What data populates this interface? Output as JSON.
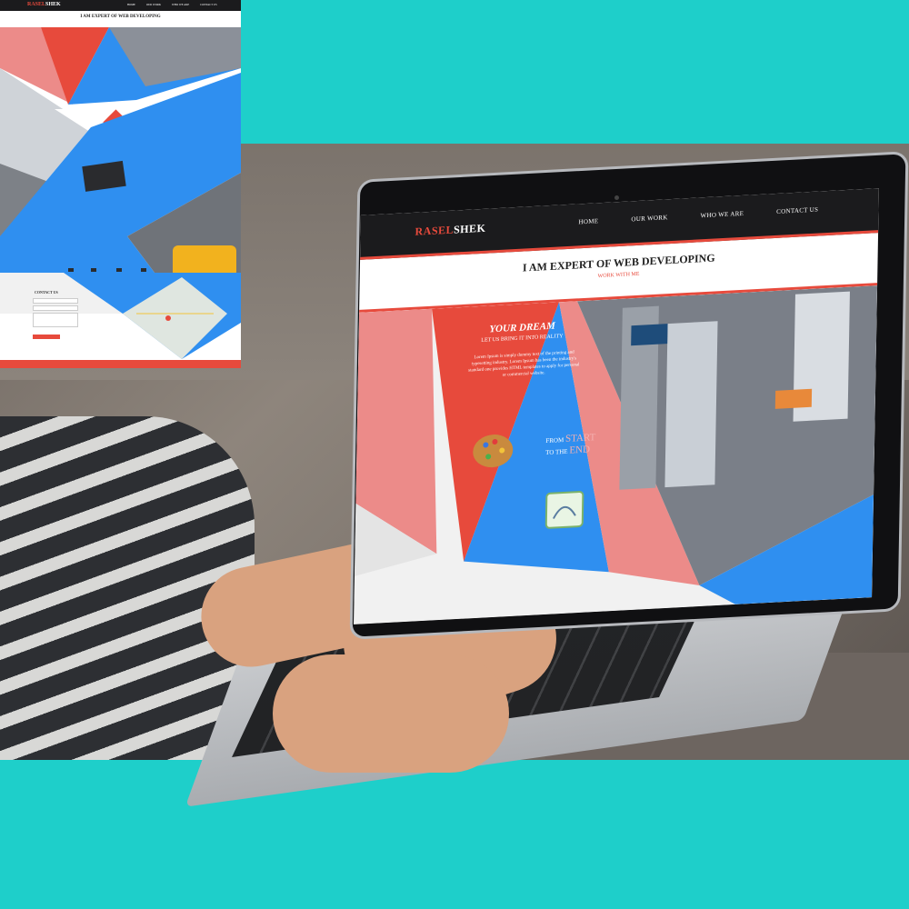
{
  "site": {
    "logo_part1": "RASEL",
    "logo_part2": "SHEK",
    "nav": [
      "HOME",
      "OUR WORK",
      "WHO WE ARE",
      "CONTACT US"
    ],
    "hero_title": "I AM EXPERT OF WEB DEVELOPING",
    "hero_subtitle": "WORK WITH ME",
    "dream": {
      "title": "YOUR DREAM",
      "subtitle": "LET US BRING IT INTO REALITY",
      "body": "Lorem Ipsum is simply dummy text of the printing and typesetting industry. Lorem Ipsum has been the industry's standard one provides HTML templates to apply for personal or commercial website."
    },
    "from_start": {
      "line1_prefix": "FROM",
      "line1_emph": "START",
      "line2_prefix": "TO THE",
      "line2_emph": "END"
    }
  },
  "inset": {
    "logo_part1": "RASEL",
    "logo_part2": "SHEK",
    "nav": [
      "HOME",
      "OUR WORK",
      "WHO WE ARE",
      "CONTACT US"
    ],
    "title": "I AM EXPERT OF WEB DEVELOPING",
    "contact_heading": "CONTACT US"
  },
  "colors": {
    "teal_band": "#1ecfca",
    "accent_red": "#e74a3c",
    "accent_blue": "#2f8ff0",
    "accent_pink": "#ec8b89",
    "nav_dark": "#1b1b1d"
  }
}
